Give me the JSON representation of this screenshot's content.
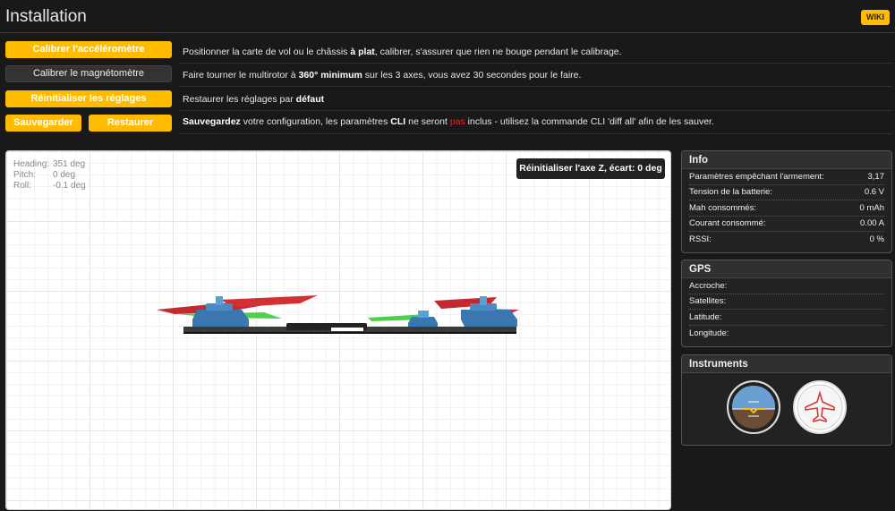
{
  "header": {
    "title": "Installation",
    "wiki_label": "WIKI"
  },
  "actions": {
    "calibrate_acc": {
      "label": "Calibrer l'accéléromètre",
      "desc_1": "Positionner la carte de vol ou le châssis ",
      "desc_bold": "à plat",
      "desc_2": ", calibrer, s'assurer que rien ne bouge pendant le calibrage."
    },
    "calibrate_mag": {
      "label": "Calibrer le magnétomètre",
      "desc_1": "Faire tourner le multirotor à ",
      "desc_bold": "360° minimum",
      "desc_2": " sur les 3 axes, vous avez 30 secondes pour le faire."
    },
    "reset": {
      "label": "Réinitialiser les réglages",
      "desc_1": "Restaurer les réglages par ",
      "desc_bold": "défaut"
    },
    "backup": {
      "save_label": "Sauvegarder",
      "restore_label": "Restaurer",
      "desc_bold1": "Sauvegardez",
      "desc_1": " votre configuration, les paramètres ",
      "desc_bold2": "CLI",
      "desc_2": " ne seront ",
      "desc_red": "pas",
      "desc_3": " inclus - utilisez la commande CLI 'diff all' afin de les sauver."
    }
  },
  "model": {
    "heading_label": "Heading:",
    "heading_value": "351 deg",
    "pitch_label": "Pitch:",
    "pitch_value": "0 deg",
    "roll_label": "Roll:",
    "roll_value": "-0.1 deg",
    "reset_z_label": "Réinitialiser l'axe Z, écart: 0 deg"
  },
  "info": {
    "title": "Info",
    "rows": [
      {
        "label": "Paramètres empêchant l'armement:",
        "value": "3,17"
      },
      {
        "label": "Tension de la batterie:",
        "value": "0.6 V"
      },
      {
        "label": "Mah consommés:",
        "value": "0 mAh"
      },
      {
        "label": "Courant consommé:",
        "value": "0.00 A"
      },
      {
        "label": "RSSI:",
        "value": "0 %"
      }
    ]
  },
  "gps": {
    "title": "GPS",
    "rows": [
      {
        "label": "Accroche:",
        "value": ""
      },
      {
        "label": "Satellites:",
        "value": ""
      },
      {
        "label": "Latitude:",
        "value": ""
      },
      {
        "label": "Longitude:",
        "value": ""
      }
    ]
  },
  "instruments": {
    "title": "Instruments",
    "gauges": [
      "attitude-indicator-icon",
      "heading-indicator-icon"
    ]
  },
  "colors": {
    "accent": "#ffbb00",
    "background": "#191919",
    "panel": "#222222",
    "red_text": "#ee2222"
  }
}
